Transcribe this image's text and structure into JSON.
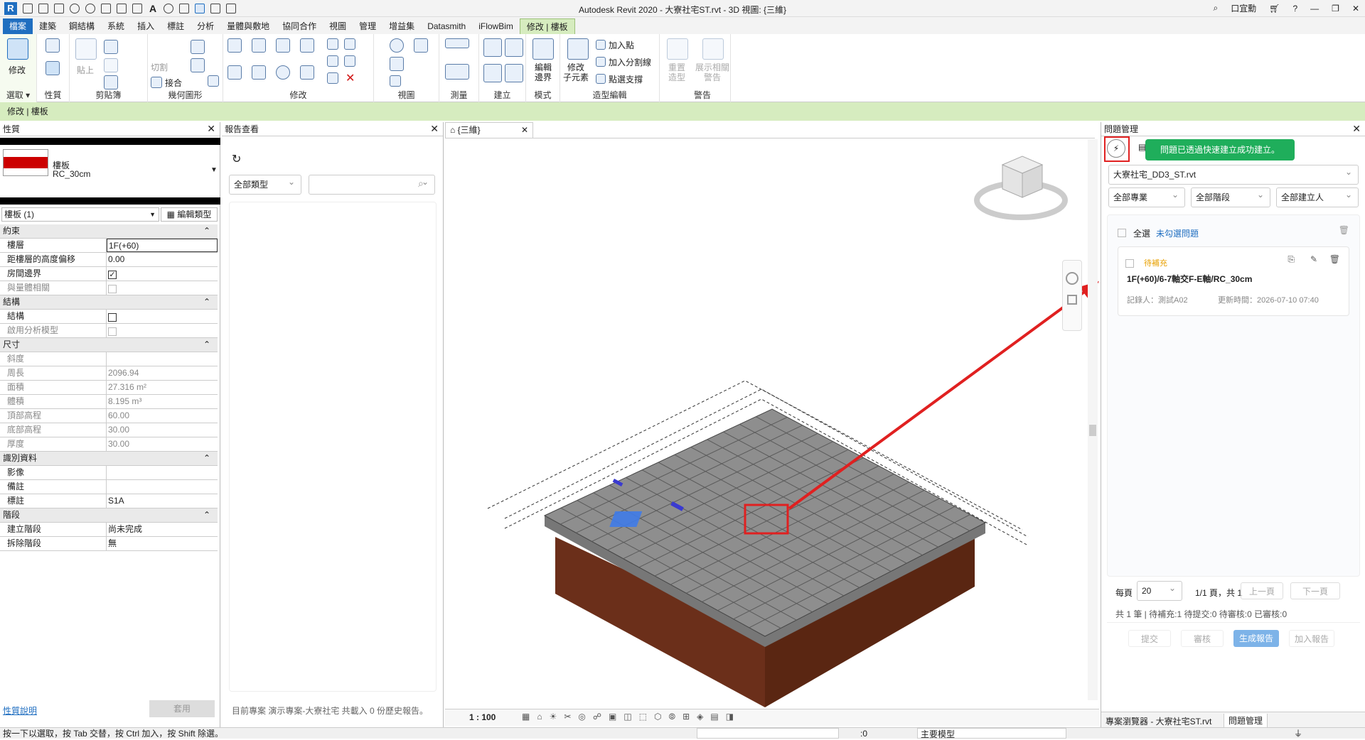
{
  "titlebar": {
    "title": "Autodesk Revit 2020 - 大寮社宅ST.rvt - 3D 視圖: {三維}",
    "user": "口宜勳"
  },
  "ribbon_tabs": [
    "檔案",
    "建築",
    "鋼結構",
    "系統",
    "插入",
    "標註",
    "分析",
    "量體與敷地",
    "協同合作",
    "視圖",
    "管理",
    "增益集",
    "Datasmith",
    "iFlowBim",
    "修改 | 樓板"
  ],
  "ribbon_groups": [
    "選取",
    "性質",
    "剪貼簿",
    "幾何圖形",
    "修改",
    "視圖",
    "測量",
    "建立",
    "模式",
    "造型編輯",
    "警告"
  ],
  "ribbon_buttons": {
    "modify": "修改",
    "paste": "貼上",
    "cut": "切割",
    "join": "接合",
    "edit_boundary": "編輯\n邊界",
    "modify_sub": "修改\n子元素",
    "add_point": "加入點",
    "add_split": "加入分割線",
    "pick_supports": "點選支撐",
    "reset_shape": "重置\n造型",
    "show_warnings": "展示相關\n警告",
    "select_dropdown": "選取 ▾"
  },
  "context_bar": "修改 | 樓板",
  "properties": {
    "title": "性質",
    "type_name": "樓板",
    "type_sub": "RC_30cm",
    "instance_selector": "樓板 (1)",
    "edit_type": "編輯類型",
    "help_link": "性質說明",
    "apply": "套用",
    "rows": [
      {
        "section": "約束"
      },
      {
        "k": "樓層",
        "v": "1F(+60)",
        "edit": true
      },
      {
        "k": "距樓層的高度偏移",
        "v": "0.00"
      },
      {
        "k": "房間邊界",
        "check": "on"
      },
      {
        "k": "與量體相關",
        "check": "dis",
        "grey": true
      },
      {
        "section": "結構"
      },
      {
        "k": "結構",
        "check": "off"
      },
      {
        "k": "啟用分析模型",
        "check": "dis",
        "grey": true
      },
      {
        "section": "尺寸"
      },
      {
        "k": "斜度",
        "v": "",
        "grey": true
      },
      {
        "k": "周長",
        "v": "2096.94",
        "grey": true
      },
      {
        "k": "面積",
        "v": "27.316 m²",
        "grey": true
      },
      {
        "k": "體積",
        "v": "8.195 m³",
        "grey": true
      },
      {
        "k": "頂部高程",
        "v": "60.00",
        "grey": true
      },
      {
        "k": "底部高程",
        "v": "30.00",
        "grey": true
      },
      {
        "k": "厚度",
        "v": "30.00",
        "grey": true
      },
      {
        "section": "識別資料"
      },
      {
        "k": "影像",
        "v": ""
      },
      {
        "k": "備註",
        "v": ""
      },
      {
        "k": "標註",
        "v": "S1A"
      },
      {
        "section": "階段"
      },
      {
        "k": "建立階段",
        "v": "尚未完成"
      },
      {
        "k": "拆除階段",
        "v": "無"
      }
    ]
  },
  "report": {
    "title": "報告查看",
    "type_filter": "全部類型",
    "footer": "目前專案 演示專案-大寮社宅 共載入 0 份歷史報告。"
  },
  "view": {
    "tab": "{三維}",
    "scale": "1 : 100"
  },
  "issues": {
    "title": "問題管理",
    "toast": "問題已透過快速建立成功建立。",
    "project_file": "大寮社宅_DD3_ST.rvt",
    "filters": [
      "全部專業",
      "全部階段",
      "全部建立人"
    ],
    "select_all": "全選",
    "unchecked_link": "未勾選問題",
    "card": {
      "status": "待補充",
      "title": "1F(+60)/6-7軸交F-E軸/RC_30cm",
      "recorder": "記錄人：測試A02",
      "updated": "更新時間：2026-07-10 07:40"
    },
    "per_page_label": "每頁",
    "per_page": "20",
    "page_info": "1/1 頁，共 1",
    "prev": "上一頁",
    "next": "下一頁",
    "summary": "共 1 筆 | 待補充:1 待提交:0 待審核:0 已審核:0",
    "buttons": [
      "提交",
      "審核",
      "生成報告",
      "加入報告"
    ],
    "bottom_tabs": [
      "專案瀏覽器 - 大寮社宅ST.rvt",
      "問題管理"
    ]
  },
  "status": {
    "hint": "按一下以選取，按 Tab 交替，按 Ctrl 加入，按 Shift 除選。",
    "zero": ":0",
    "model": "主要模型"
  },
  "colors": {
    "accent": "#1f6ec0",
    "ctx": "#d6ecbf",
    "toast": "#1fae5b",
    "highlight": "#e02020",
    "pending": "#e8a000"
  }
}
